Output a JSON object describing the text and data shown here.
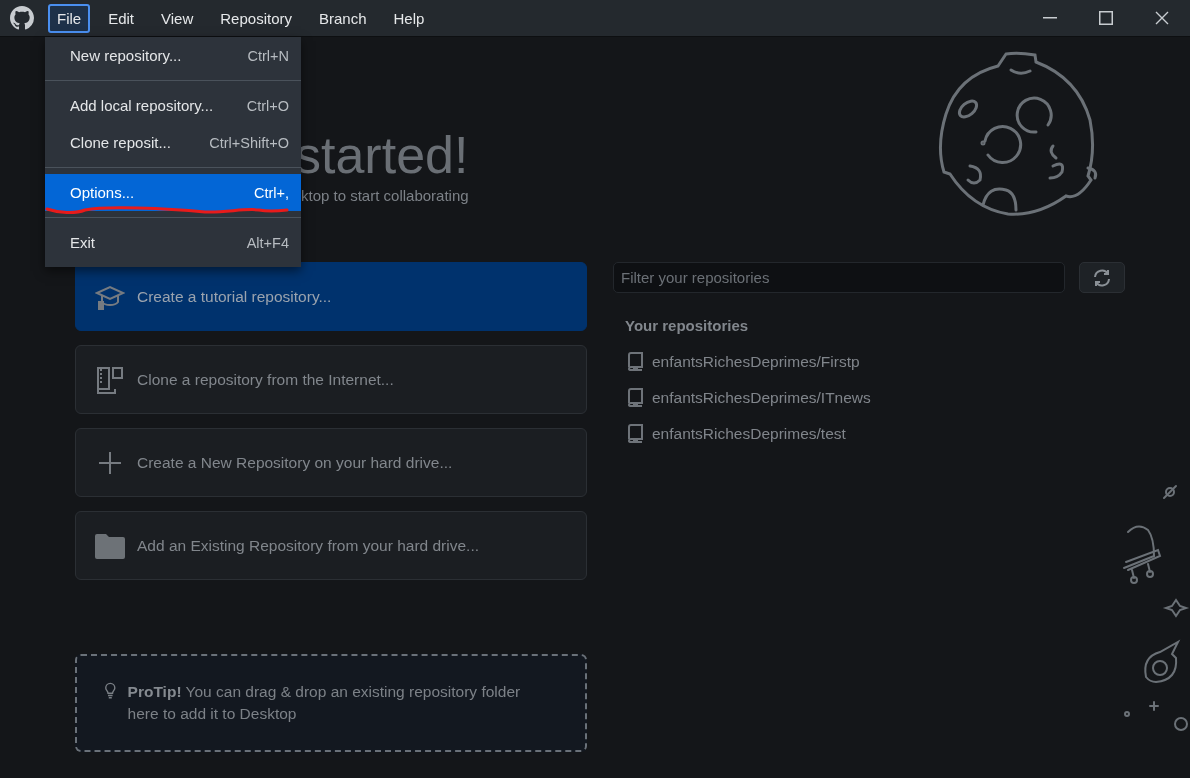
{
  "menu_bar": [
    {
      "label": "File",
      "selected": true
    },
    {
      "label": "Edit",
      "selected": false
    },
    {
      "label": "View",
      "selected": false
    },
    {
      "label": "Repository",
      "selected": false
    },
    {
      "label": "Branch",
      "selected": false
    },
    {
      "label": "Help",
      "selected": false
    }
  ],
  "file_menu": [
    {
      "kind": "item",
      "label": "New repository...",
      "shortcut": "Ctrl+N",
      "selected": false
    },
    {
      "kind": "separator"
    },
    {
      "kind": "item",
      "label": "Add local repository...",
      "shortcut": "Ctrl+O",
      "selected": false
    },
    {
      "kind": "item",
      "label": "Clone reposit...",
      "shortcut": "Ctrl+Shift+O",
      "selected": false
    },
    {
      "kind": "separator"
    },
    {
      "kind": "item",
      "label": "Options...",
      "shortcut": "Ctrl+,",
      "selected": true,
      "underlined": true
    },
    {
      "kind": "separator"
    },
    {
      "kind": "item",
      "label": "Exit",
      "shortcut": "Alt+F4",
      "selected": false
    }
  ],
  "welcome": {
    "heading": "started!",
    "subtitle": "ktop to start collaborating"
  },
  "actions": [
    {
      "kind": "mortarboard",
      "label": "Create a tutorial repository...",
      "selected": true
    },
    {
      "kind": "clone",
      "label": "Clone a repository from the Internet...",
      "selected": false
    },
    {
      "kind": "plus",
      "label": "Create a New Repository on your hard drive...",
      "selected": false
    },
    {
      "kind": "folder",
      "label": "Add an Existing Repository from your hard drive...",
      "selected": false
    }
  ],
  "protip": {
    "text": "**ProTip!** You can drag & drop an existing repository folder here to add it to Desktop"
  },
  "repositories": {
    "filter_placeholder": "Filter your repositories",
    "heading": "Your repositories",
    "items": [
      "enfantsRichesDeprimes/Firstp",
      "enfantsRichesDeprimes/ITnews",
      "enfantsRichesDeprimes/test"
    ]
  }
}
